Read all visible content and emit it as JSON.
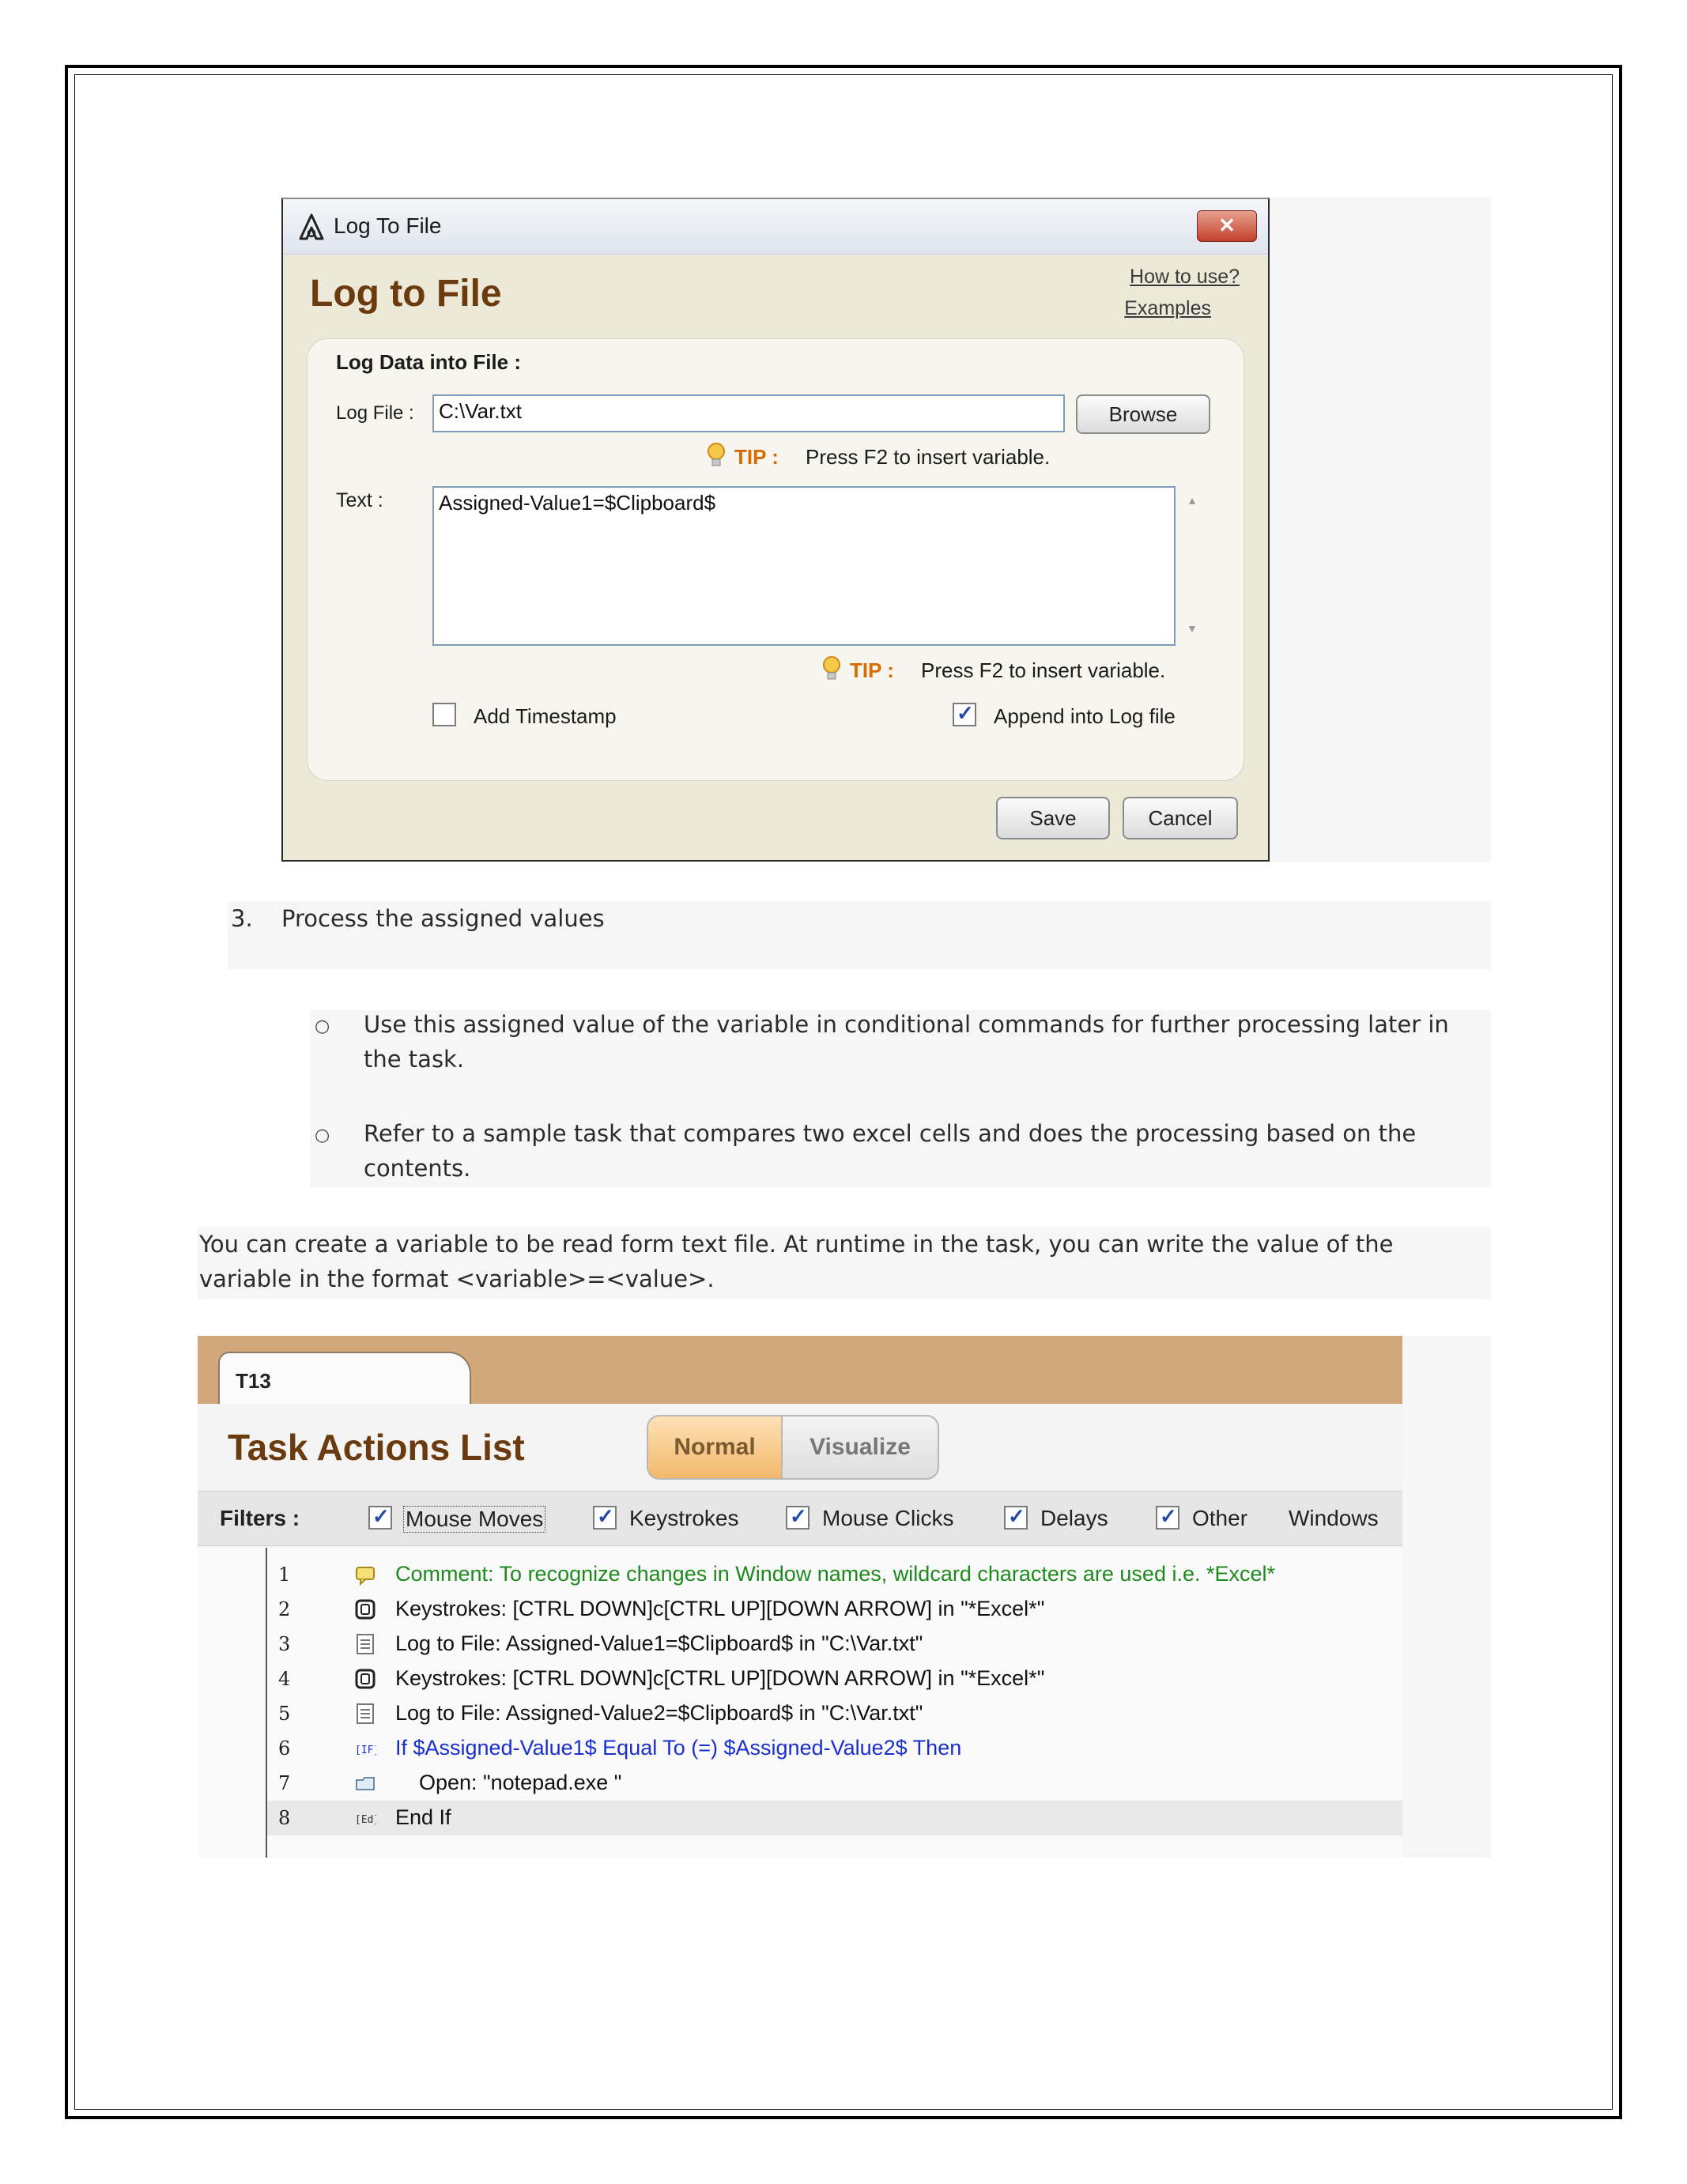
{
  "log_dialog": {
    "window_title": "Log To File",
    "heading": "Log to File",
    "links": {
      "how_to_use": "How to use?",
      "examples": "Examples"
    },
    "section_title": "Log Data into File :",
    "log_file_label": "Log File :",
    "log_file_value": "C:\\Var.txt",
    "browse_label": "Browse",
    "tip_label": "TIP :",
    "tip_text": "Press F2 to insert variable.",
    "text_label": "Text :",
    "text_value": "Assigned-Value1=$Clipboard$",
    "add_timestamp_label": "Add Timestamp",
    "add_timestamp_checked": false,
    "append_label": "Append into Log file",
    "append_checked": true,
    "save_label": "Save",
    "cancel_label": "Cancel"
  },
  "doc": {
    "step3_number": "3.",
    "step3_text": "Process the assigned values",
    "bullets": [
      {
        "line1": "Use this assigned value of the variable in conditional commands for further processing later in",
        "line2": "the task."
      },
      {
        "line1": "Refer to a sample task that compares two excel cells and does the processing based on the",
        "line2": "contents."
      }
    ],
    "para_line1": "You can create a variable to be read form text file. At runtime in the task, you can write the value of the",
    "para_line2": "variable in the format <variable>=<value>."
  },
  "task_actions": {
    "tab_label": "T13",
    "title": "Task Actions List",
    "view_modes": {
      "normal": "Normal",
      "visualize": "Visualize"
    },
    "filters_label": "Filters :",
    "filters": [
      {
        "label": "Mouse Moves",
        "checked": true
      },
      {
        "label": "Keystrokes",
        "checked": true
      },
      {
        "label": "Mouse Clicks",
        "checked": true
      },
      {
        "label": "Delays",
        "checked": true
      },
      {
        "label": "Other",
        "checked": true
      },
      {
        "label": "Windows",
        "checked": false
      }
    ],
    "rows": [
      {
        "num": "1",
        "icon": "comment-icon",
        "text": "Comment: To recognize changes in Window names, wildcard characters are used i.e. *Excel*",
        "color": "#1e8a1e"
      },
      {
        "num": "2",
        "icon": "keystroke-icon",
        "text": "Keystrokes: [CTRL DOWN]c[CTRL UP][DOWN ARROW] in \"*Excel*\"",
        "color": "#111111"
      },
      {
        "num": "3",
        "icon": "log-file-icon",
        "text": "Log to File: Assigned-Value1=$Clipboard$ in \"C:\\Var.txt\"",
        "color": "#111111"
      },
      {
        "num": "4",
        "icon": "keystroke-icon",
        "text": "Keystrokes: [CTRL DOWN]c[CTRL UP][DOWN ARROW] in \"*Excel*\"",
        "color": "#111111"
      },
      {
        "num": "5",
        "icon": "log-file-icon",
        "text": "Log to File: Assigned-Value2=$Clipboard$ in \"C:\\Var.txt\"",
        "color": "#111111"
      },
      {
        "num": "6",
        "icon": "if-icon",
        "text": "If $Assigned-Value1$ Equal To (=) $Assigned-Value2$ Then",
        "color": "#1a2fd0"
      },
      {
        "num": "7",
        "icon": "open-folder-icon",
        "text": "    Open: \"notepad.exe \"",
        "color": "#111111"
      },
      {
        "num": "8",
        "icon": "end-if-icon",
        "text": "End If",
        "color": "#111111"
      }
    ]
  }
}
